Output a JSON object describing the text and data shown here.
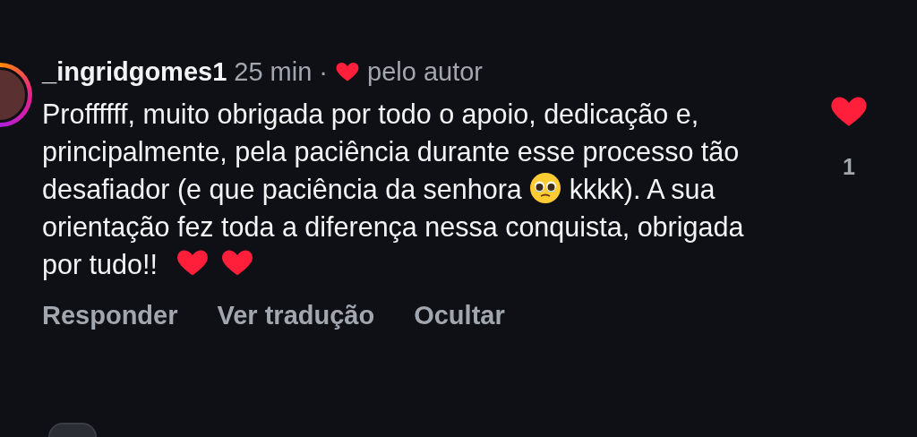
{
  "comment": {
    "username": "_ingridgomes1",
    "time": "25 min",
    "separator": "·",
    "author_liked": true,
    "author_like_label": "pelo autor",
    "body": [
      {
        "kind": "text",
        "text": "Proffffff, muito obrigada por todo o apoio, dedicação e, principalmente, pela paciência durante esse processo tão desafiador (e que paciência da senhora "
      },
      {
        "kind": "face"
      },
      {
        "kind": "text",
        "text": " kkkk). A sua orientação fez toda a diferença nessa conquista, obrigada por tudo!! "
      },
      {
        "kind": "heart"
      },
      {
        "kind": "heart"
      }
    ],
    "liked": true,
    "like_count": "1",
    "actions": [
      "Responder",
      "Ver tradução",
      "Ocultar"
    ]
  }
}
